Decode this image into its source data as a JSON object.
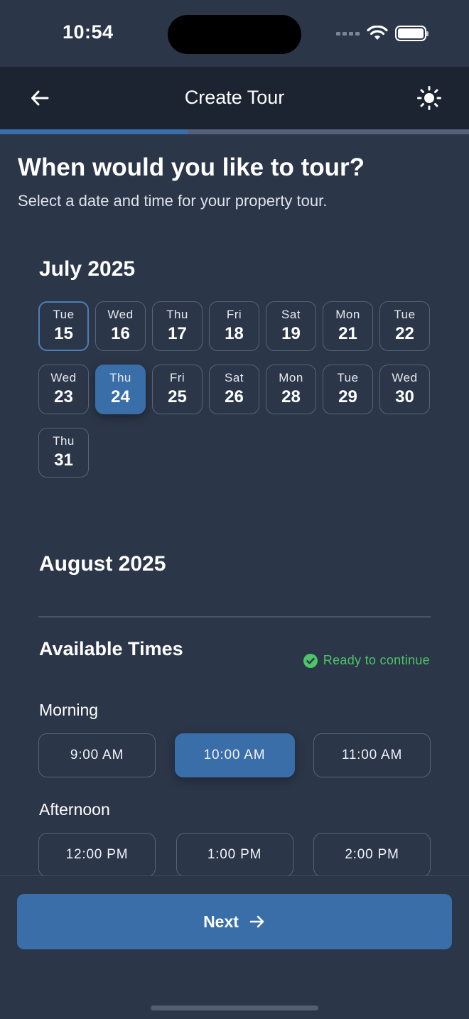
{
  "status_bar": {
    "time": "10:54"
  },
  "header": {
    "title": "Create Tour"
  },
  "progress": {
    "fraction": 0.4
  },
  "page": {
    "heading": "When would you like to tour?",
    "subheading": "Select a date and time for your property tour."
  },
  "months": [
    {
      "title": "July 2025",
      "days": [
        {
          "dow": "Tue",
          "num": "15",
          "state": "today"
        },
        {
          "dow": "Wed",
          "num": "16"
        },
        {
          "dow": "Thu",
          "num": "17"
        },
        {
          "dow": "Fri",
          "num": "18"
        },
        {
          "dow": "Sat",
          "num": "19"
        },
        {
          "dow": "Mon",
          "num": "21"
        },
        {
          "dow": "Tue",
          "num": "22"
        },
        {
          "dow": "Wed",
          "num": "23"
        },
        {
          "dow": "Thu",
          "num": "24",
          "state": "selected"
        },
        {
          "dow": "Fri",
          "num": "25"
        },
        {
          "dow": "Sat",
          "num": "26"
        },
        {
          "dow": "Mon",
          "num": "28"
        },
        {
          "dow": "Tue",
          "num": "29"
        },
        {
          "dow": "Wed",
          "num": "30"
        },
        {
          "dow": "Thu",
          "num": "31"
        }
      ]
    },
    {
      "title": "August 2025",
      "days": []
    }
  ],
  "times": {
    "title": "Available Times",
    "status": "Ready to continue",
    "morning": {
      "label": "Morning",
      "slots": [
        {
          "label": "9:00 AM"
        },
        {
          "label": "10:00 AM",
          "selected": true
        },
        {
          "label": "11:00 AM"
        }
      ]
    },
    "afternoon": {
      "label": "Afternoon",
      "slots": [
        {
          "label": "12:00 PM"
        },
        {
          "label": "1:00 PM"
        },
        {
          "label": "2:00 PM"
        }
      ]
    }
  },
  "footer": {
    "next_label": "Next"
  },
  "colors": {
    "background": "#2b3648",
    "header": "#1c2331",
    "accent": "#3a6ea8",
    "success": "#4ec367"
  },
  "icons": {
    "back": "arrow-left-icon",
    "theme": "sun-icon",
    "next": "arrow-right-icon",
    "status": "check-circle-icon"
  }
}
